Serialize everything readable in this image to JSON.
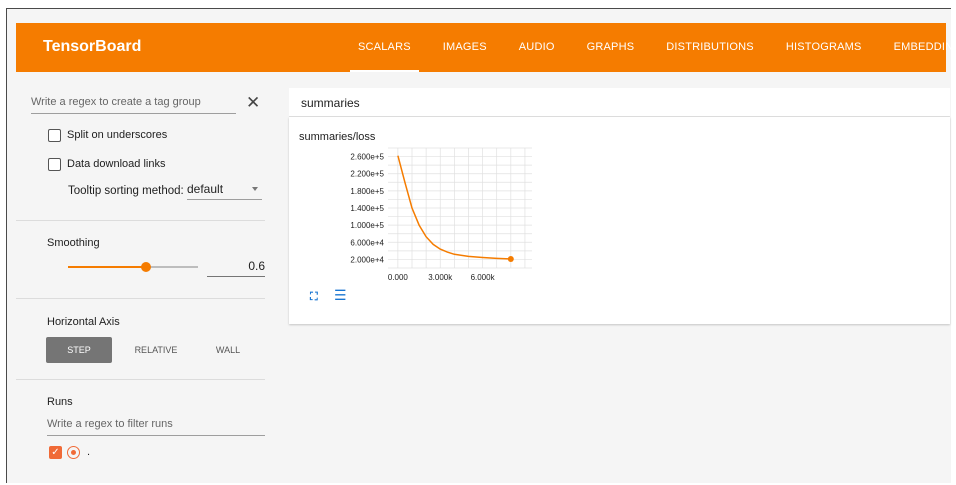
{
  "app": {
    "brand": "TensorBoard",
    "tabs": [
      {
        "label": "SCALARS",
        "active": true
      },
      {
        "label": "IMAGES"
      },
      {
        "label": "AUDIO"
      },
      {
        "label": "GRAPHS"
      },
      {
        "label": "DISTRIBUTIONS"
      },
      {
        "label": "HISTOGRAMS"
      },
      {
        "label": "EMBEDDINGS"
      }
    ],
    "accent_color": "#f57c00"
  },
  "sidebar": {
    "tag_regex_placeholder": "Write a regex to create a tag group",
    "split_underscores_label": "Split on underscores",
    "split_underscores_checked": false,
    "download_links_label": "Data download links",
    "download_links_checked": false,
    "tooltip_sort_label": "Tooltip sorting method:",
    "tooltip_sort_value": "default",
    "smoothing_label": "Smoothing",
    "smoothing_value": "0.6",
    "smoothing_fraction": 0.6,
    "horizontal_axis_label": "Horizontal Axis",
    "axis_options": [
      "STEP",
      "RELATIVE",
      "WALL"
    ],
    "axis_selected": "STEP",
    "runs_label": "Runs",
    "runs_filter_placeholder": "Write a regex to filter runs",
    "run_name": ".",
    "run_color": "#f06a37"
  },
  "main": {
    "group_name": "summaries",
    "card_title": "summaries/loss",
    "icons": [
      "fullscreen-icon",
      "data-table-icon"
    ]
  },
  "chart_data": {
    "type": "line",
    "title": "summaries/loss",
    "xlabel": "",
    "ylabel": "",
    "x_tick_labels": [
      "0.000",
      "3.000k",
      "6.000k"
    ],
    "y_tick_labels": [
      "2.000e+4",
      "6.000e+4",
      "1.000e+5",
      "1.400e+5",
      "1.800e+5",
      "2.200e+5",
      "2.600e+5"
    ],
    "xlim": [
      -700,
      9500
    ],
    "ylim": [
      0,
      280000
    ],
    "grid": true,
    "series": [
      {
        "color": "#f57c00",
        "x": [
          0,
          500,
          1000,
          1500,
          2000,
          2500,
          3000,
          3500,
          4000,
          5000,
          6000,
          7000,
          8000
        ],
        "y": [
          262000,
          200000,
          140000,
          100000,
          73000,
          55000,
          44000,
          37000,
          32000,
          27000,
          24500,
          22500,
          21000
        ]
      }
    ]
  }
}
